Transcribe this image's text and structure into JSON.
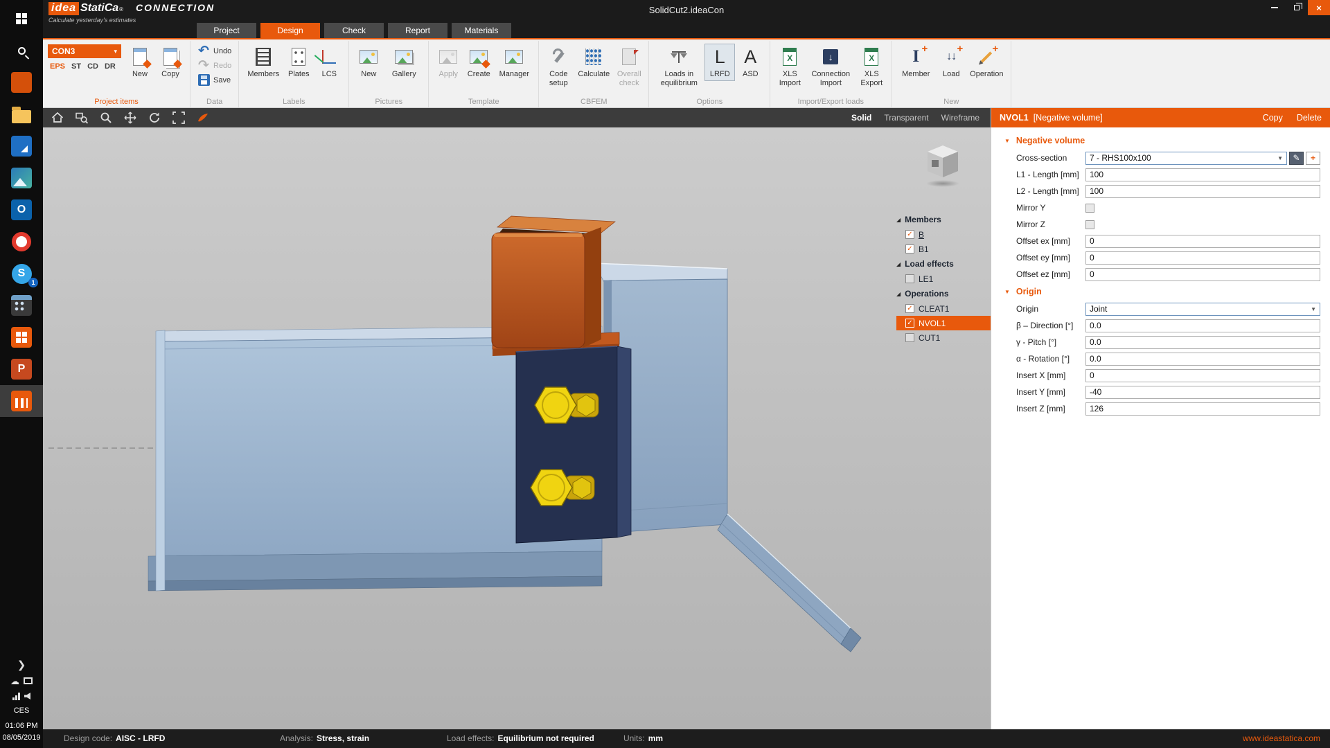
{
  "colors": {
    "accent": "#e8590c",
    "member_blue": "#9fb6cf",
    "bolt_yellow": "#f0d411",
    "negative_volume_orange": "#c75a1e"
  },
  "taskbar": {
    "apps": [
      "start",
      "search",
      "idea-connection",
      "file-explorer",
      "store",
      "photos",
      "outlook",
      "opera",
      "skype",
      "calculator",
      "idea-tools",
      "powerpoint",
      "idea-statica"
    ],
    "skype_badge": "1",
    "language": "CES",
    "time": "01:06 PM",
    "date": "08/05/2019"
  },
  "titlebar": {
    "title": "SolidCut2.ideaCon",
    "brand": {
      "idea": "idea",
      "statica": "StatiCa",
      "reg": "®",
      "product": "CONNECTION",
      "tagline": "Calculate yesterday's estimates"
    }
  },
  "tabs": [
    {
      "label": "Project"
    },
    {
      "label": "Design",
      "active": true
    },
    {
      "label": "Check"
    },
    {
      "label": "Report"
    },
    {
      "label": "Materials"
    }
  ],
  "ribbon": {
    "project_items": {
      "combo": "CON3",
      "modes": [
        "EPS",
        "ST",
        "CD",
        "DR"
      ],
      "new": "New",
      "copy": "Copy",
      "label": "Project items"
    },
    "data": {
      "undo": "Undo",
      "redo": "Redo",
      "save": "Save",
      "label": "Data"
    },
    "labels": {
      "members": "Members",
      "plates": "Plates",
      "lcs": "LCS",
      "label": "Labels"
    },
    "pictures": {
      "new": "New",
      "gallery": "Gallery",
      "label": "Pictures"
    },
    "template": {
      "apply": "Apply",
      "create": "Create",
      "manager": "Manager",
      "label": "Template"
    },
    "cbfem": {
      "code_setup": "Code setup",
      "calculate": "Calculate",
      "overall_check": "Overall check",
      "label": "CBFEM"
    },
    "options": {
      "loads_eq": "Loads in equilibrium",
      "lrfd": "LRFD",
      "asd": "ASD",
      "label": "Options"
    },
    "import_export": {
      "xls_import": "XLS Import",
      "conn_import": "Connection Import",
      "xls_export": "XLS Export",
      "label": "Import/Export loads"
    },
    "new": {
      "member": "Member",
      "load": "Load",
      "operation": "Operation",
      "label": "New"
    }
  },
  "viewport": {
    "modes": [
      "Solid",
      "Transparent",
      "Wireframe"
    ],
    "active_mode": "Solid"
  },
  "tree": {
    "groups": [
      {
        "label": "Members",
        "items": [
          {
            "label": "B",
            "checked": true
          },
          {
            "label": "B1",
            "checked": true
          }
        ]
      },
      {
        "label": "Load effects",
        "items": [
          {
            "label": "LE1",
            "checked": false
          }
        ]
      },
      {
        "label": "Operations",
        "items": [
          {
            "label": "CLEAT1",
            "checked": true
          },
          {
            "label": "NVOL1",
            "checked": true,
            "selected": true
          },
          {
            "label": "CUT1",
            "checked": false
          }
        ]
      }
    ]
  },
  "props": {
    "header": {
      "name": "NVOL1",
      "type": "[Negative volume]",
      "copy": "Copy",
      "delete": "Delete"
    },
    "nv": {
      "title": "Negative volume",
      "cross_section": {
        "label": "Cross-section",
        "value": "7 - RHS100x100"
      },
      "l1": {
        "label": "L1 - Length [mm]",
        "value": "100"
      },
      "l2": {
        "label": "L2 - Length [mm]",
        "value": "100"
      },
      "mirror_y": {
        "label": "Mirror Y",
        "checked": false
      },
      "mirror_z": {
        "label": "Mirror Z",
        "checked": false
      },
      "offset_ex": {
        "label": "Offset ex [mm]",
        "value": "0"
      },
      "offset_ey": {
        "label": "Offset ey [mm]",
        "value": "0"
      },
      "offset_ez": {
        "label": "Offset ez [mm]",
        "value": "0"
      }
    },
    "origin": {
      "title": "Origin",
      "origin": {
        "label": "Origin",
        "value": "Joint"
      },
      "beta": {
        "label": "β – Direction [°]",
        "value": "0.0"
      },
      "gamma": {
        "label": "γ - Pitch [°]",
        "value": "0.0"
      },
      "alpha": {
        "label": "α - Rotation [°]",
        "value": "0.0"
      },
      "insert_x": {
        "label": "Insert X [mm]",
        "value": "0"
      },
      "insert_y": {
        "label": "Insert Y [mm]",
        "value": "-40"
      },
      "insert_z": {
        "label": "Insert Z [mm]",
        "value": "126"
      }
    }
  },
  "statusbar": {
    "design_code_label": "Design code:",
    "design_code": "AISC - LRFD",
    "analysis_label": "Analysis:",
    "analysis": "Stress, strain",
    "load_effects_label": "Load effects:",
    "load_effects": "Equilibrium not required",
    "units_label": "Units:",
    "units": "mm",
    "website": "www.ideastatica.com"
  }
}
